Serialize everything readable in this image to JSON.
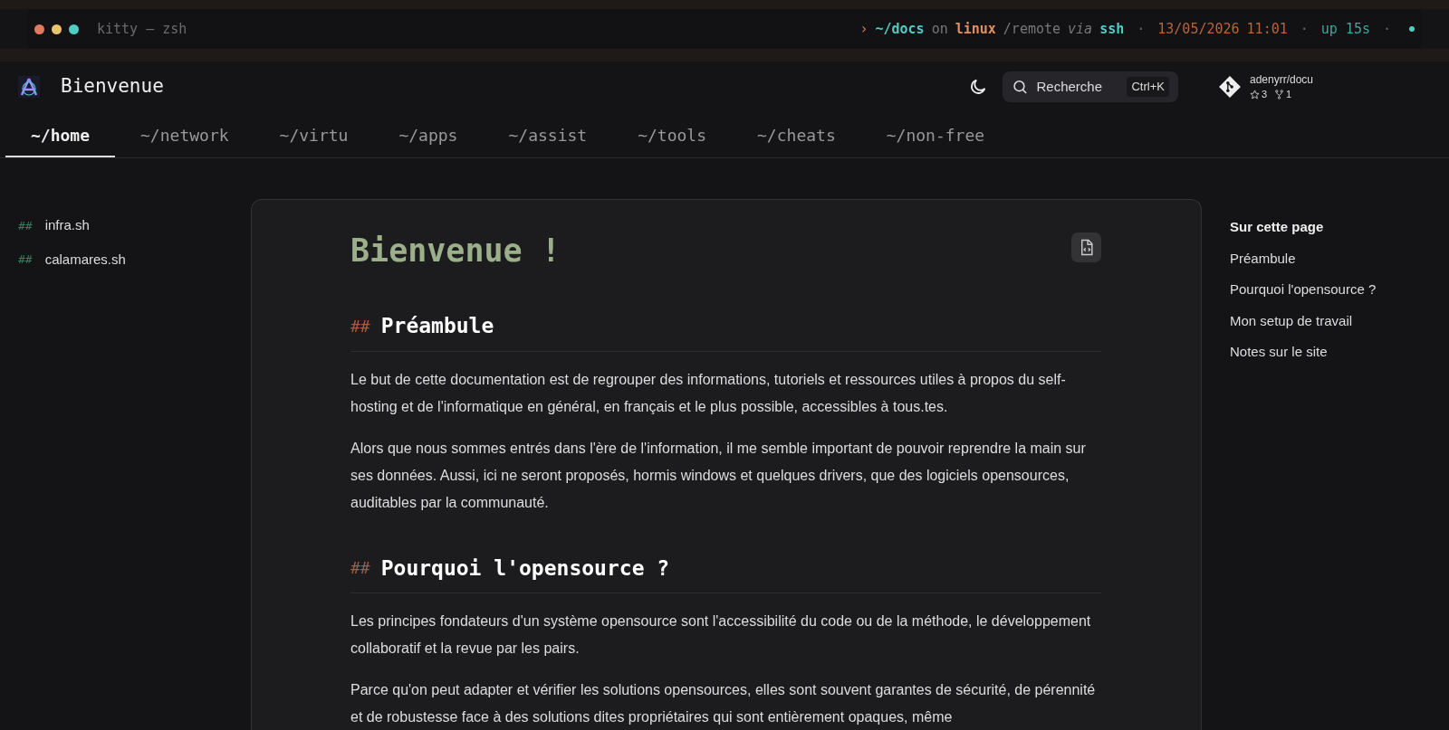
{
  "terminal_bar": {
    "title": "kitty — zsh",
    "prompt": [
      {
        "kind": "arrow",
        "text": "›"
      },
      {
        "kind": "path",
        "text": "~/docs"
      },
      {
        "kind": "dim",
        "text": "on"
      },
      {
        "kind": "branch",
        "text": "linux"
      },
      {
        "kind": "dim",
        "text": "/remote"
      },
      {
        "kind": "italic",
        "text": "via"
      },
      {
        "kind": "tool",
        "text": "ssh"
      },
      {
        "kind": "sep",
        "text": "·"
      },
      {
        "kind": "date",
        "text": "13/05/2026"
      },
      {
        "kind": "date",
        "text": "11:01"
      },
      {
        "kind": "sep",
        "text": "·"
      },
      {
        "kind": "uptime",
        "text": "up 15s"
      },
      {
        "kind": "sep",
        "text": "·"
      }
    ]
  },
  "header": {
    "site_title": "Bienvenue",
    "search": {
      "placeholder": "Recherche",
      "shortcut": "Ctrl+K"
    },
    "repo": {
      "name": "adenyrr/docu",
      "stars": "3",
      "forks": "1"
    }
  },
  "nav_tabs": [
    {
      "label": "~/home",
      "selected": true
    },
    {
      "label": "~/network",
      "selected": false
    },
    {
      "label": "~/virtu",
      "selected": false
    },
    {
      "label": "~/apps",
      "selected": false
    },
    {
      "label": "~/assist",
      "selected": false
    },
    {
      "label": "~/tools",
      "selected": false
    },
    {
      "label": "~/cheats",
      "selected": false
    },
    {
      "label": "~/non-free",
      "selected": false
    }
  ],
  "sidebar": {
    "items": [
      {
        "marker": "##",
        "label": "infra.sh"
      },
      {
        "marker": "##",
        "label": "calamares.sh"
      }
    ]
  },
  "article": {
    "title": "Bienvenue !",
    "sections": [
      {
        "marker": "##",
        "heading": "Préambule",
        "paragraphs": [
          "Le but de cette documentation est de regrouper des informations, tutoriels et ressources utiles à propos du self-hosting et de l'informatique en général, en français et le plus possible, accessibles à tous.tes.",
          "Alors que nous sommes entrés dans l'ère de l'information, il me semble important de pouvoir reprendre la main sur ses données. Aussi, ici ne seront proposés, hormis windows et quelques drivers, que des logiciels opensources, auditables par la communauté."
        ]
      },
      {
        "marker": "##",
        "heading": "Pourquoi l'opensource ?",
        "paragraphs": [
          "Les principes fondateurs d'un système opensource sont l'accessibilité du code ou de la méthode, le développement collaboratif et la revue par les pairs.",
          "Parce qu'on peut adapter et vérifier les solutions opensources, elles sont souvent garantes de sécurité, de pérennité et de robustesse face à des solutions dites propriétaires qui sont entièrement opaques, même"
        ]
      }
    ]
  },
  "toc": {
    "title": "Sur cette page",
    "items": [
      "Préambule",
      "Pourquoi l'opensource ?",
      "Mon setup de travail",
      "Notes sur le site"
    ]
  }
}
